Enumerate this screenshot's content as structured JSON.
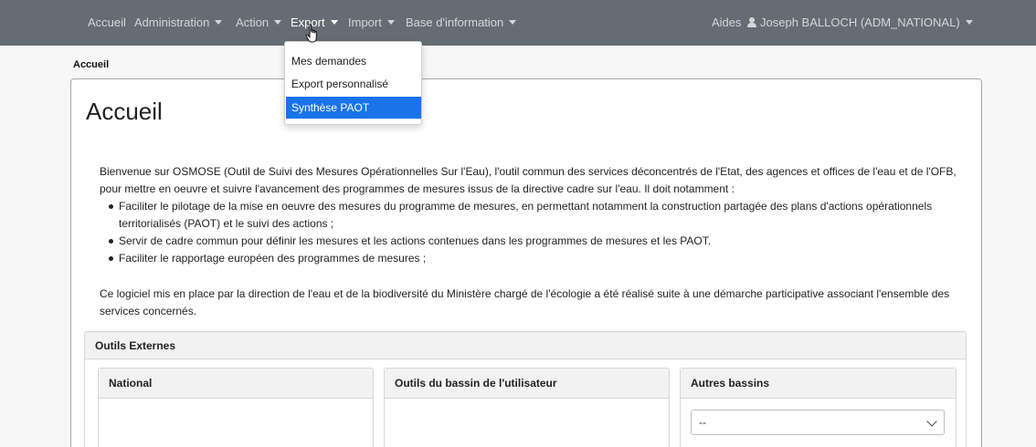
{
  "navbar": {
    "items": [
      {
        "label": "Accueil",
        "caret": false
      },
      {
        "label": "Administration",
        "caret": true
      },
      {
        "label": "Action",
        "caret": true
      },
      {
        "label": "Export",
        "caret": true
      },
      {
        "label": "Import",
        "caret": true
      },
      {
        "label": "Base d'information",
        "caret": true
      }
    ],
    "help_label": "Aides",
    "user_label": "Joseph BALLOCH (ADM_NATIONAL)",
    "user_icon": "user-icon",
    "background_color": "#666c73"
  },
  "export_menu": {
    "items": [
      {
        "label": "Mes demandes"
      },
      {
        "label": "Export personnalisé"
      },
      {
        "label": "Synthèse PAOT"
      }
    ],
    "highlight_color": "#1a73e8"
  },
  "breadcrumb": {
    "current": "Accueil"
  },
  "main": {
    "title": "Accueil",
    "intro": "Bienvenue sur OSMOSE (Outil de Suivi des Mesures Opérationnelles Sur l'Eau), l'outil commun des services déconcentrés de l'Etat, des agences et offices de l'eau et de l'OFB, pour mettre en oeuvre et suivre l'avancement des programmes de mesures issus de la directive cadre sur l'eau. Il doit notamment :",
    "bullets": [
      "Faciliter le pilotage de la mise en oeuvre des mesures du programme de mesures, en permettant notamment la construction partagée des plans d'actions opérationnels territorialisés (PAOT) et le suivi des actions ;",
      "Servir de cadre commun pour définir les mesures et les actions contenues dans les programmes de mesures et les PAOT.",
      "Faciliter le rapportage européen des programmes de mesures ;"
    ],
    "outro": "Ce logiciel mis en place par la direction de l'eau et de la biodiversité du Ministère chargé de l'écologie a été réalisé suite à une démarche participative associant l'ensemble des services concernés."
  },
  "external_tools": {
    "title": "Outils Externes",
    "national": {
      "title": "National"
    },
    "basin": {
      "title": "Outils du bassin de l'utilisateur"
    },
    "other_basins": {
      "title": "Autres bassins",
      "selected": "--"
    }
  }
}
